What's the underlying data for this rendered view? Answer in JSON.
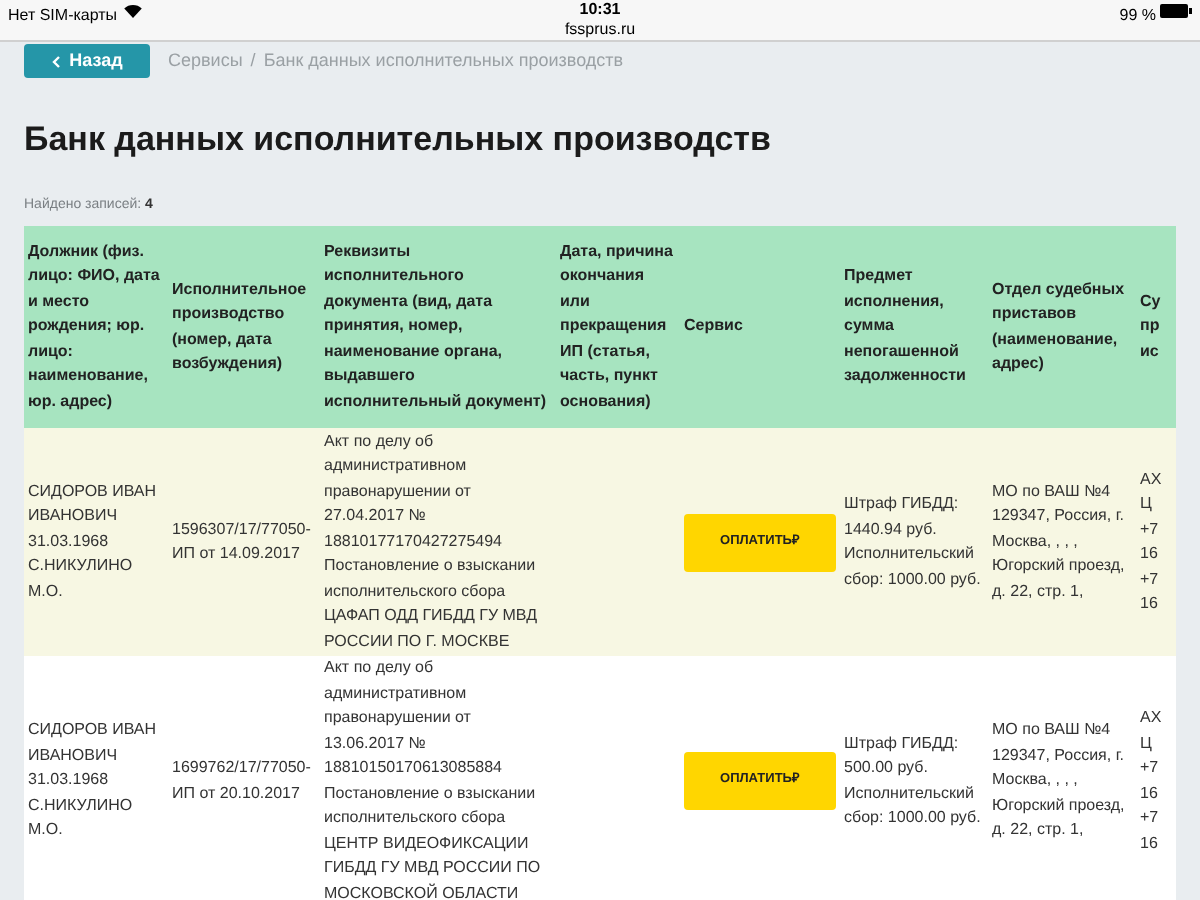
{
  "status_bar": {
    "carrier": "Нет SIM-карты",
    "time": "10:31",
    "url": "fssprus.ru",
    "battery": "99 %"
  },
  "nav": {
    "back_button": "Назад",
    "separator": "/",
    "breadcrumbs": [
      "Сервисы",
      "Банк данных исполнительных производств"
    ]
  },
  "title": "Банк данных исполнительных производств",
  "found": {
    "label": "Найдено записей:",
    "count": "4"
  },
  "table": {
    "columns": [
      {
        "label": "Должник (физ. лицо: ФИО, дата и место рождения; юр. лицо: наименование, юр. адрес)"
      },
      {
        "label": "Исполнительное производство (номер, дата возбуждения)"
      },
      {
        "label": "Реквизиты исполнительного документа (вид, дата принятия, номер, наименование органа, выдавшего исполнительный документ)"
      },
      {
        "label": "Дата, причина окончания или прекращения ИП (статья, часть, пункт основания)"
      },
      {
        "label": "Сервис"
      },
      {
        "label": "Предмет исполнения, сумма непогашенной задолженности"
      },
      {
        "label": "Отдел судебных приставов (наименование, адрес)"
      },
      {
        "label_lines": [
          "Су",
          "пр",
          "ис"
        ]
      }
    ],
    "rows": [
      {
        "debtor": "СИДОРОВ ИВАН ИВАНОВИЧ 31.03.1968 С.НИКУЛИНО М.О.",
        "proceeding": "1596307/17/77050-ИП от 14.09.2017",
        "document": "Акт по делу об административном правонарушении от 27.04.2017 № 18810177170427275494 Постановление о взыскании исполнительского сбора ЦАФАП ОДД ГИБДД ГУ МВД РОССИИ ПО Г. МОСКВЕ",
        "pay_button": "ОПЛАТИТЬ₽",
        "subject": "Штраф ГИБДД: 1440.94 руб. Исполнительский сбор: 1000.00 руб.",
        "department": "МО по ВАШ №4 129347, Россия, г. Москва, , , , Югорский проезд, д. 22, стр. 1,",
        "column_8_lines": [
          "АХ",
          "Ц",
          "+7",
          "16",
          "+7",
          "16"
        ]
      },
      {
        "debtor": "СИДОРОВ ИВАН ИВАНОВИЧ 31.03.1968 С.НИКУЛИНО М.О.",
        "proceeding": "1699762/17/77050-ИП от 20.10.2017",
        "document": "Акт по делу об административном правонарушении от 13.06.2017 № 18810150170613085884 Постановление о взыскании исполнительского сбора ЦЕНТР ВИДЕОФИКСАЦИИ ГИБДД ГУ МВД РОССИИ ПО МОСКОВСКОЙ ОБЛАСТИ",
        "pay_button": "ОПЛАТИТЬ₽",
        "subject": "Штраф ГИБДД: 500.00 руб. Исполнительский сбор: 1000.00 руб.",
        "department": "МО по ВАШ №4 129347, Россия, г. Москва, , , , Югорский проезд, д. 22, стр. 1,",
        "column_8_lines": [
          "АХ",
          "Ц",
          "+7",
          "16",
          "+7",
          "16"
        ]
      }
    ]
  }
}
